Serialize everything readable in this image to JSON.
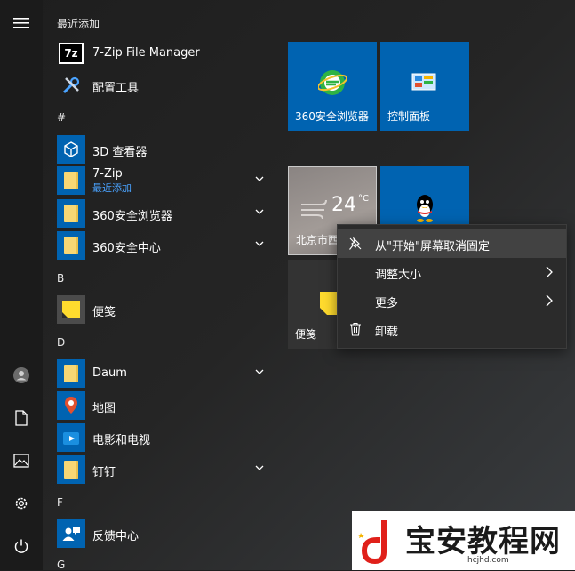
{
  "rail": {
    "menu_icon": "hamburger-icon",
    "user_icon": "user-icon",
    "documents_icon": "document-icon",
    "pictures_icon": "picture-icon",
    "settings_icon": "gear-icon",
    "power_icon": "power-icon"
  },
  "app_list": {
    "sections": {
      "recent": "最近添加",
      "hash": "#",
      "b": "B",
      "d": "D",
      "f": "F",
      "g": "G"
    },
    "items": [
      {
        "label": "7-Zip File Manager",
        "icon": "7zip-icon"
      },
      {
        "label": "配置工具",
        "icon": "tools-icon"
      },
      {
        "label": "3D 查看器",
        "icon": "3d-viewer-icon"
      },
      {
        "label": "7-Zip",
        "sub": "最近添加",
        "icon": "folder-icon"
      },
      {
        "label": "360安全浏览器",
        "icon": "folder-icon"
      },
      {
        "label": "360安全中心",
        "icon": "folder-icon"
      },
      {
        "label": "便笺",
        "icon": "sticky-notes-icon"
      },
      {
        "label": "Daum",
        "icon": "folder-icon"
      },
      {
        "label": "地图",
        "icon": "maps-icon"
      },
      {
        "label": "电影和电视",
        "icon": "movies-icon"
      },
      {
        "label": "钉钉",
        "icon": "folder-icon"
      },
      {
        "label": "反馈中心",
        "icon": "feedback-icon"
      }
    ]
  },
  "tiles": {
    "browser": "360安全浏览器",
    "control_panel": "控制面板",
    "weather_temp": "24",
    "weather_unit": "°C",
    "weather_city": "北京市西",
    "sticky": "便笺"
  },
  "context_menu": {
    "items": [
      {
        "label": "从\"开始\"屏幕取消固定",
        "icon": "unpin-icon"
      },
      {
        "label": "调整大小",
        "icon": "",
        "submenu": true
      },
      {
        "label": "更多",
        "icon": "",
        "submenu": true
      },
      {
        "label": "卸载",
        "icon": "trash-icon"
      }
    ]
  },
  "watermark": {
    "text": "宝安教程网",
    "url": "hcjhd.com"
  },
  "colors": {
    "tile_blue": "#0063b1",
    "accent_link": "#4aa3ff",
    "menu_bg": "#2b2b2b"
  }
}
